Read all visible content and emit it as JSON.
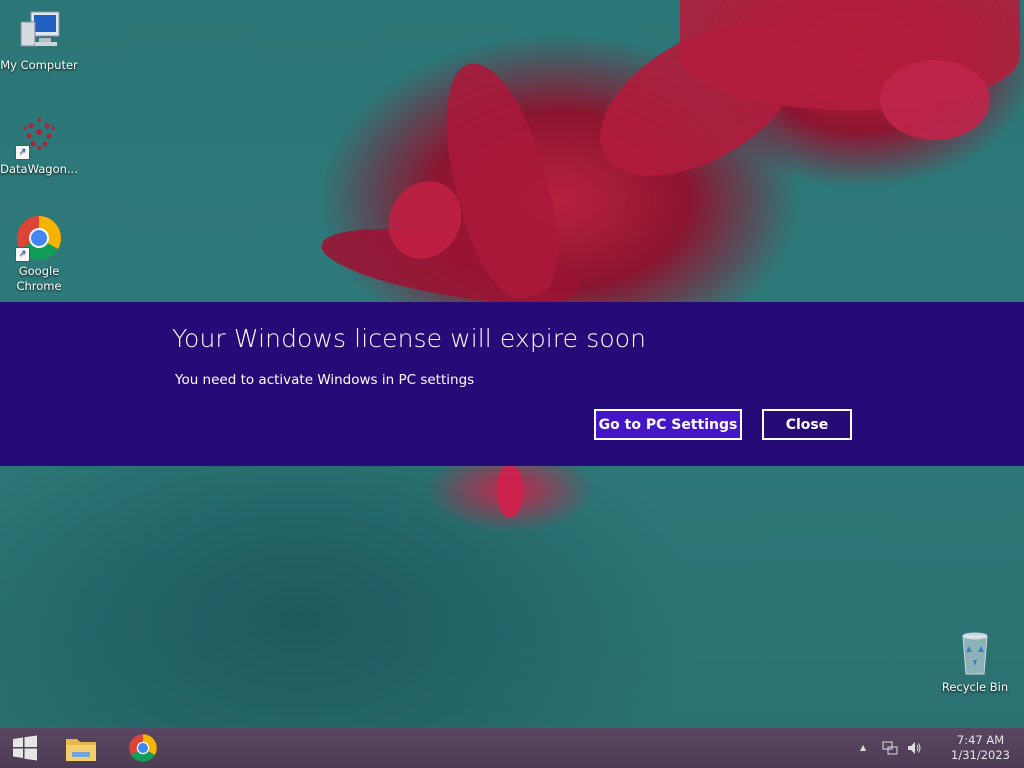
{
  "desktop": {
    "icons": [
      {
        "label": "My Computer",
        "icon": "computer-icon"
      },
      {
        "label": "DataWagon...",
        "icon": "datawagon-icon"
      },
      {
        "label": "Google Chrome",
        "icon": "chrome-icon"
      },
      {
        "label": "Recycle Bin",
        "icon": "recycle-bin-icon"
      }
    ]
  },
  "banner": {
    "title": "Your Windows license will expire soon",
    "message": "You need to activate Windows in PC settings",
    "settings_button": "Go to PC Settings",
    "close_button": "Close",
    "background_color": "#250a78",
    "accent_color": "#4416c8"
  },
  "taskbar": {
    "pinned": [
      {
        "name": "start-button",
        "icon": "windows-logo-icon"
      },
      {
        "name": "file-explorer",
        "icon": "folder-icon"
      },
      {
        "name": "chrome",
        "icon": "chrome-icon"
      }
    ],
    "tray": {
      "show_hidden": "▲",
      "time": "7:47 AM",
      "date": "1/31/2023"
    }
  }
}
